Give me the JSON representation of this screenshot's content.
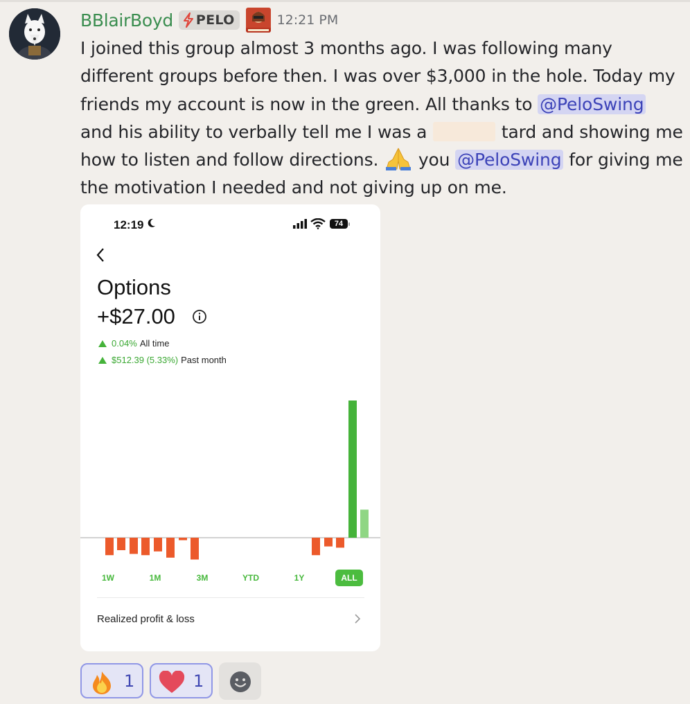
{
  "message": {
    "author": "BBlairBoyd",
    "role_tag": "PELO",
    "role_badge_icon": "peloswing-badge-icon",
    "timestamp": "12:21 PM",
    "text_part_1": "I joined this group almost 3 months ago. I was following many different groups before then. I was over $3,000 in the hole. Today my friends my account is now in the green. All thanks to ",
    "mention_1": "@PeloSwing",
    "text_part_2": " and his ability to verbally tell me I was a ",
    "text_part_3": " tard and showing me how to listen and follow directions. ",
    "emoji_inline": "folded-hands-icon",
    "text_part_4": " you ",
    "mention_2": "@PeloSwing",
    "text_part_5": " for giving me the motivation I needed and not giving up on me.",
    "colors": {
      "author": "#3a8d4f",
      "mention_bg": "#d4d5f2",
      "mention_text": "#3c43b8"
    }
  },
  "attachment": {
    "status_time": "12:19",
    "battery": "74",
    "title": "Options",
    "value": "+$27.00",
    "stat_all_time_value": "0.04%",
    "stat_all_time_label": "All time",
    "stat_month_value": "$512.39 (5.33%)",
    "stat_month_label": "Past month",
    "ranges": [
      "1W",
      "1M",
      "3M",
      "YTD",
      "1Y",
      "ALL"
    ],
    "active_range": "ALL",
    "realized_label": "Realized profit & loss",
    "colors": {
      "positive": "#45b33a",
      "negative": "#ec5a2b",
      "positive_light": "#8fd684"
    }
  },
  "chart_data": {
    "type": "bar",
    "x": [
      1,
      2,
      3,
      4,
      5,
      6,
      7,
      8,
      9,
      10,
      11,
      12,
      13,
      14,
      15,
      16,
      17,
      18,
      19,
      20
    ],
    "values": [
      -0.28,
      -0.2,
      -0.26,
      -0.28,
      -0.22,
      -0.32,
      -0.04,
      -0.35,
      0,
      0,
      0,
      0,
      0,
      0,
      0,
      0,
      -0.28,
      -0.14,
      -0.16,
      2.2,
      0.45
    ],
    "note_values": "relative bar heights, no axis printed",
    "xlabel": "",
    "ylabel": "",
    "grid": false
  },
  "reactions": [
    {
      "icon": "fire-emoji-icon",
      "count": "1"
    },
    {
      "icon": "heart-emoji-icon",
      "count": "1"
    }
  ],
  "add_reaction_icon": "add-reaction-smiley-icon"
}
